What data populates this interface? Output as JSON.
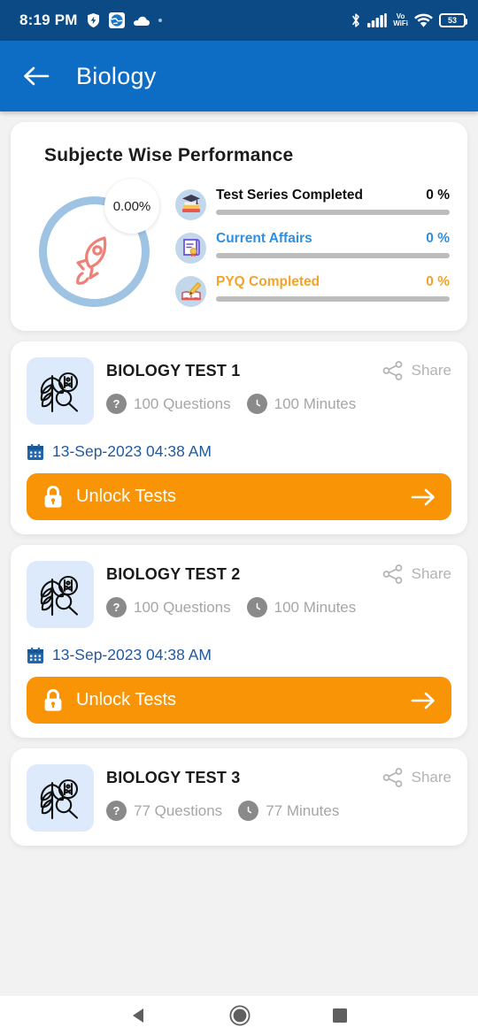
{
  "status_bar": {
    "time": "8:19 PM",
    "battery_percent": "53",
    "vo_label": "Vo",
    "wifi_label": "WiFi",
    "icons": [
      "shield-icon",
      "globe-app-icon",
      "cloud-icon",
      "dot-icon",
      "bluetooth-icon",
      "cellular-signal-icon",
      "vowifi-icon",
      "wifi-icon",
      "battery-icon"
    ]
  },
  "app_bar": {
    "title": "Biology",
    "back_icon": "arrow-left-icon"
  },
  "performance": {
    "title": "Subjecte Wise Performance",
    "ring_percent_label": "0.00%",
    "ring_color": "#9fc3e3",
    "rocket_color": "#ee8077",
    "metrics": [
      {
        "icon": "graduation-books-icon",
        "label": "Test Series Completed",
        "value": "0 %",
        "color": "#101010",
        "progress": 0
      },
      {
        "icon": "certificate-scroll-icon",
        "label": "Current Affairs",
        "value": "0 %",
        "color": "#2f8fe0",
        "progress": 0
      },
      {
        "icon": "pencil-book-icon",
        "label": "PYQ Completed",
        "value": "0 %",
        "color": "#f2a32c",
        "progress": 0
      }
    ]
  },
  "share_label": "Share",
  "unlock_label": "Unlock Tests",
  "accent_orange": "#f89406",
  "tests": [
    {
      "name": "BIOLOGY TEST 1",
      "questions": "100 Questions",
      "minutes": "100 Minutes",
      "date": "13-Sep-2023 04:38 AM",
      "has_unlock": true
    },
    {
      "name": "BIOLOGY TEST 2",
      "questions": "100 Questions",
      "minutes": "100 Minutes",
      "date": "13-Sep-2023 04:38 AM",
      "has_unlock": true
    },
    {
      "name": "BIOLOGY TEST 3",
      "questions": "77 Questions",
      "minutes": "77 Minutes",
      "date": "",
      "has_unlock": false
    }
  ],
  "nav_bar": {
    "back": "back-triangle-icon",
    "home": "home-circle-icon",
    "recents": "recents-square-icon"
  }
}
